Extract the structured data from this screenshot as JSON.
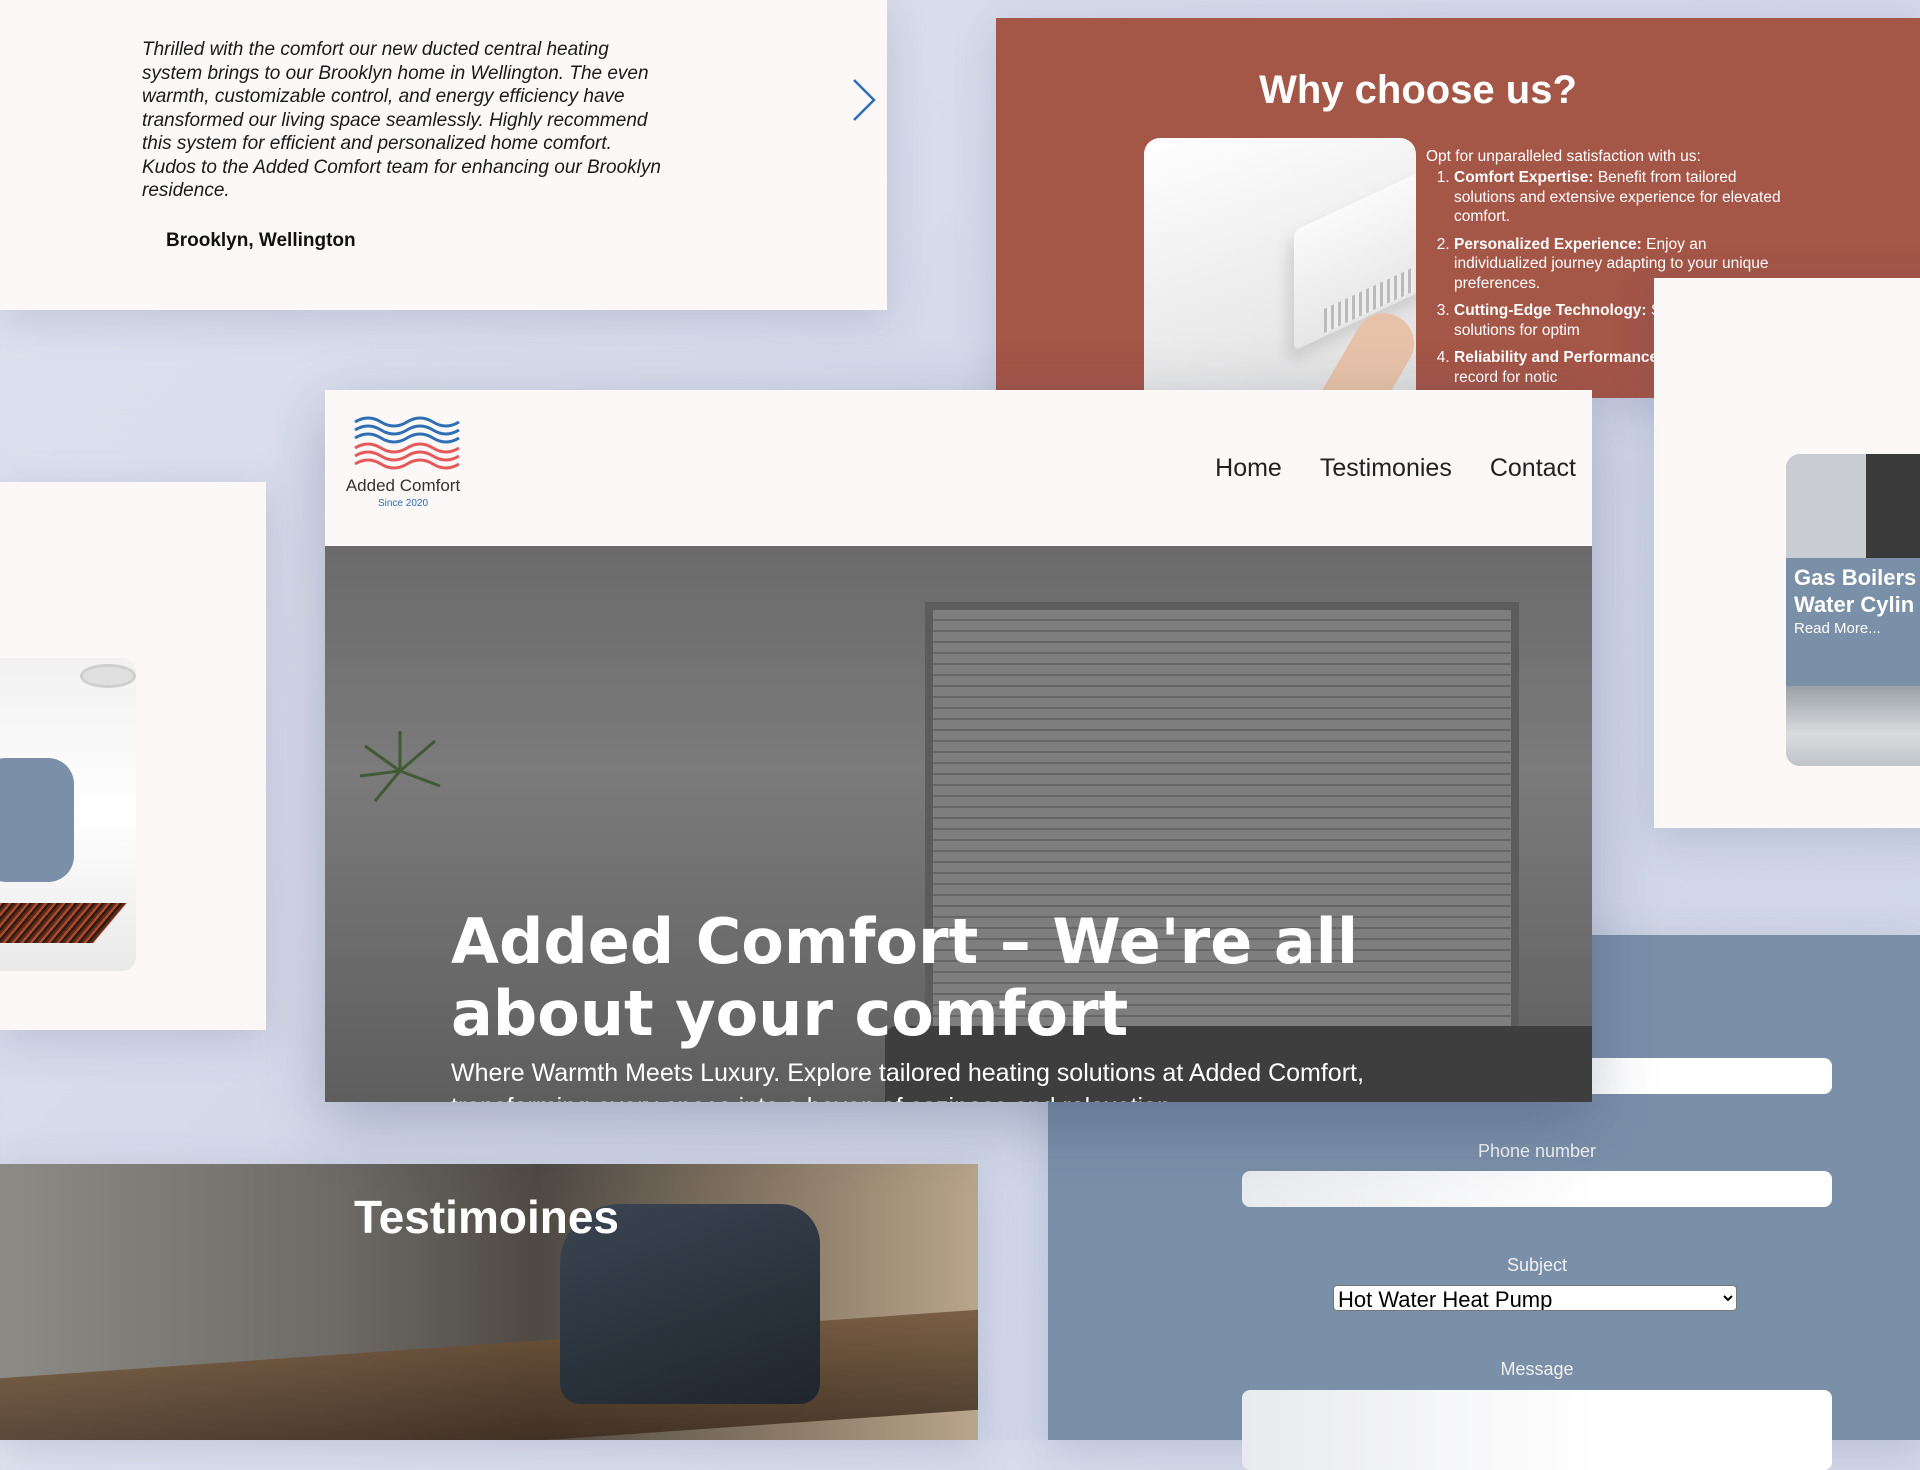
{
  "testimonial": {
    "quote": "Thrilled with the comfort our new ducted central heating system brings to our Brooklyn home in Wellington. The even warmth, customizable control, and energy efficiency have transformed our living space seamlessly. Highly recommend this system for efficient and personalized home comfort. Kudos to the Added Comfort team for enhancing our Brooklyn residence.",
    "author": "Brooklyn, Wellington",
    "next_icon": "chevron-right-icon"
  },
  "why": {
    "title": "Why choose us?",
    "intro": "Opt for unparalleled satisfaction with us:",
    "items": [
      {
        "head": "Comfort Expertise:",
        "text": " Benefit from tailored solutions and extensive experience for elevated comfort."
      },
      {
        "head": "Personalized Experience:",
        "text": " Enjoy an individualized journey adapting to your unique preferences."
      },
      {
        "head": "Cutting-Edge Technology:",
        "text": " St innovative solutions for optim"
      },
      {
        "head": "Reliability and Performance:",
        "text": " proven track record for notic"
      }
    ]
  },
  "service": {
    "title_line1": "Gas Boilers",
    "title_line2": "Water Cylin",
    "read_more": "Read More..."
  },
  "header": {
    "brand": "Added Comfort",
    "since": "Since 2020",
    "nav": [
      "Home",
      "Testimonies",
      "Contact"
    ]
  },
  "hero": {
    "title": "Added Comfort – We're all about your comfort",
    "subtitle": "Where Warmth Meets Luxury. Explore tailored heating solutions at Added Comfort, transforming every space into a haven of coziness and relaxation."
  },
  "testimonies": {
    "title": "Testimoines"
  },
  "contact": {
    "phone_label": "Phone number",
    "subject_label": "Subject",
    "subject_value": "Hot Water Heat Pump",
    "message_label": "Message"
  },
  "colors": {
    "why_bg": "#a45647",
    "contact_bg": "#7a8fa8",
    "card_bg": "#fcf8f8",
    "accent_blue": "#2c6cb0"
  }
}
